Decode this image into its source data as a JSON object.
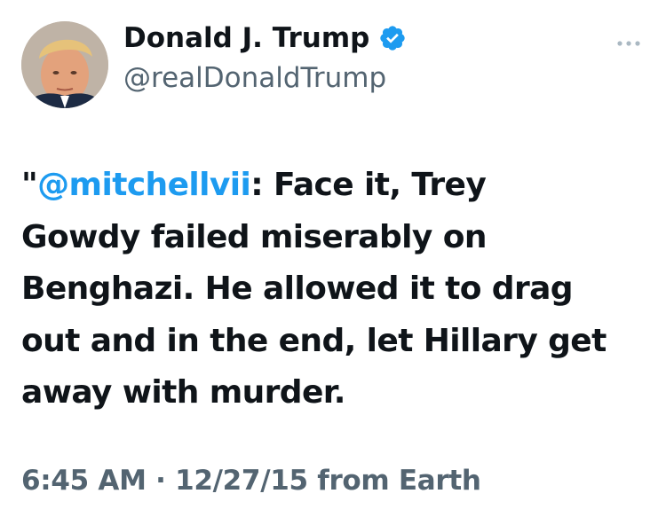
{
  "user": {
    "display_name": "Donald J. Trump",
    "handle": "@realDonaldTrump",
    "verified": true,
    "avatar": "profile-photo"
  },
  "tweet": {
    "quote_open": "\"",
    "mention": "@mitchellvii",
    "line1_rest": ": Face it, Trey",
    "line2": "Gowdy failed miserably on",
    "line3": "Benghazi. He allowed it to drag",
    "line4": "out and in the end, let Hillary get",
    "line5": "away with murder."
  },
  "meta": {
    "text": "6:45 AM · 12/27/15 from Earth"
  },
  "icons": {
    "verified": "verified-badge-icon",
    "more": "more-options-icon"
  },
  "colors": {
    "accent": "#1d9bf0",
    "text": "#0f1419",
    "secondary": "#536471"
  }
}
